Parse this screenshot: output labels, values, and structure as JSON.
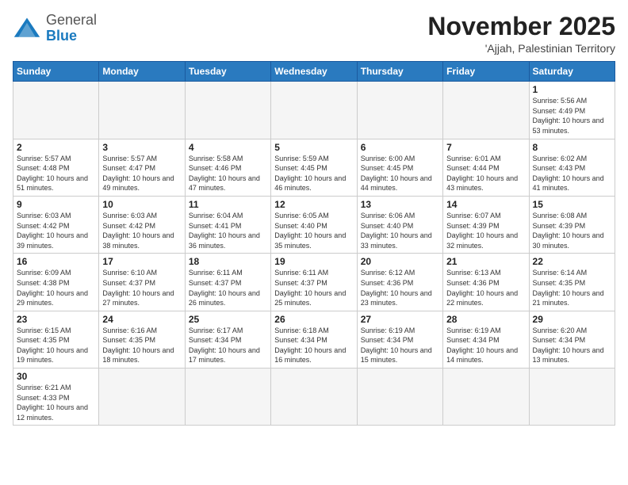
{
  "logo": {
    "general": "General",
    "blue": "Blue"
  },
  "title": "November 2025",
  "subtitle": "'Ajjah, Palestinian Territory",
  "days_of_week": [
    "Sunday",
    "Monday",
    "Tuesday",
    "Wednesday",
    "Thursday",
    "Friday",
    "Saturday"
  ],
  "weeks": [
    [
      {
        "day": "",
        "info": ""
      },
      {
        "day": "",
        "info": ""
      },
      {
        "day": "",
        "info": ""
      },
      {
        "day": "",
        "info": ""
      },
      {
        "day": "",
        "info": ""
      },
      {
        "day": "",
        "info": ""
      },
      {
        "day": "1",
        "info": "Sunrise: 5:56 AM\nSunset: 4:49 PM\nDaylight: 10 hours and 53 minutes."
      }
    ],
    [
      {
        "day": "2",
        "info": "Sunrise: 5:57 AM\nSunset: 4:48 PM\nDaylight: 10 hours and 51 minutes."
      },
      {
        "day": "3",
        "info": "Sunrise: 5:57 AM\nSunset: 4:47 PM\nDaylight: 10 hours and 49 minutes."
      },
      {
        "day": "4",
        "info": "Sunrise: 5:58 AM\nSunset: 4:46 PM\nDaylight: 10 hours and 47 minutes."
      },
      {
        "day": "5",
        "info": "Sunrise: 5:59 AM\nSunset: 4:45 PM\nDaylight: 10 hours and 46 minutes."
      },
      {
        "day": "6",
        "info": "Sunrise: 6:00 AM\nSunset: 4:45 PM\nDaylight: 10 hours and 44 minutes."
      },
      {
        "day": "7",
        "info": "Sunrise: 6:01 AM\nSunset: 4:44 PM\nDaylight: 10 hours and 43 minutes."
      },
      {
        "day": "8",
        "info": "Sunrise: 6:02 AM\nSunset: 4:43 PM\nDaylight: 10 hours and 41 minutes."
      }
    ],
    [
      {
        "day": "9",
        "info": "Sunrise: 6:03 AM\nSunset: 4:42 PM\nDaylight: 10 hours and 39 minutes."
      },
      {
        "day": "10",
        "info": "Sunrise: 6:03 AM\nSunset: 4:42 PM\nDaylight: 10 hours and 38 minutes."
      },
      {
        "day": "11",
        "info": "Sunrise: 6:04 AM\nSunset: 4:41 PM\nDaylight: 10 hours and 36 minutes."
      },
      {
        "day": "12",
        "info": "Sunrise: 6:05 AM\nSunset: 4:40 PM\nDaylight: 10 hours and 35 minutes."
      },
      {
        "day": "13",
        "info": "Sunrise: 6:06 AM\nSunset: 4:40 PM\nDaylight: 10 hours and 33 minutes."
      },
      {
        "day": "14",
        "info": "Sunrise: 6:07 AM\nSunset: 4:39 PM\nDaylight: 10 hours and 32 minutes."
      },
      {
        "day": "15",
        "info": "Sunrise: 6:08 AM\nSunset: 4:39 PM\nDaylight: 10 hours and 30 minutes."
      }
    ],
    [
      {
        "day": "16",
        "info": "Sunrise: 6:09 AM\nSunset: 4:38 PM\nDaylight: 10 hours and 29 minutes."
      },
      {
        "day": "17",
        "info": "Sunrise: 6:10 AM\nSunset: 4:37 PM\nDaylight: 10 hours and 27 minutes."
      },
      {
        "day": "18",
        "info": "Sunrise: 6:11 AM\nSunset: 4:37 PM\nDaylight: 10 hours and 26 minutes."
      },
      {
        "day": "19",
        "info": "Sunrise: 6:11 AM\nSunset: 4:37 PM\nDaylight: 10 hours and 25 minutes."
      },
      {
        "day": "20",
        "info": "Sunrise: 6:12 AM\nSunset: 4:36 PM\nDaylight: 10 hours and 23 minutes."
      },
      {
        "day": "21",
        "info": "Sunrise: 6:13 AM\nSunset: 4:36 PM\nDaylight: 10 hours and 22 minutes."
      },
      {
        "day": "22",
        "info": "Sunrise: 6:14 AM\nSunset: 4:35 PM\nDaylight: 10 hours and 21 minutes."
      }
    ],
    [
      {
        "day": "23",
        "info": "Sunrise: 6:15 AM\nSunset: 4:35 PM\nDaylight: 10 hours and 19 minutes."
      },
      {
        "day": "24",
        "info": "Sunrise: 6:16 AM\nSunset: 4:35 PM\nDaylight: 10 hours and 18 minutes."
      },
      {
        "day": "25",
        "info": "Sunrise: 6:17 AM\nSunset: 4:34 PM\nDaylight: 10 hours and 17 minutes."
      },
      {
        "day": "26",
        "info": "Sunrise: 6:18 AM\nSunset: 4:34 PM\nDaylight: 10 hours and 16 minutes."
      },
      {
        "day": "27",
        "info": "Sunrise: 6:19 AM\nSunset: 4:34 PM\nDaylight: 10 hours and 15 minutes."
      },
      {
        "day": "28",
        "info": "Sunrise: 6:19 AM\nSunset: 4:34 PM\nDaylight: 10 hours and 14 minutes."
      },
      {
        "day": "29",
        "info": "Sunrise: 6:20 AM\nSunset: 4:34 PM\nDaylight: 10 hours and 13 minutes."
      }
    ],
    [
      {
        "day": "30",
        "info": "Sunrise: 6:21 AM\nSunset: 4:33 PM\nDaylight: 10 hours and 12 minutes."
      },
      {
        "day": "",
        "info": ""
      },
      {
        "day": "",
        "info": ""
      },
      {
        "day": "",
        "info": ""
      },
      {
        "day": "",
        "info": ""
      },
      {
        "day": "",
        "info": ""
      },
      {
        "day": "",
        "info": ""
      }
    ]
  ],
  "colors": {
    "header_bg": "#2a7abf",
    "logo_blue": "#1a7abf"
  }
}
